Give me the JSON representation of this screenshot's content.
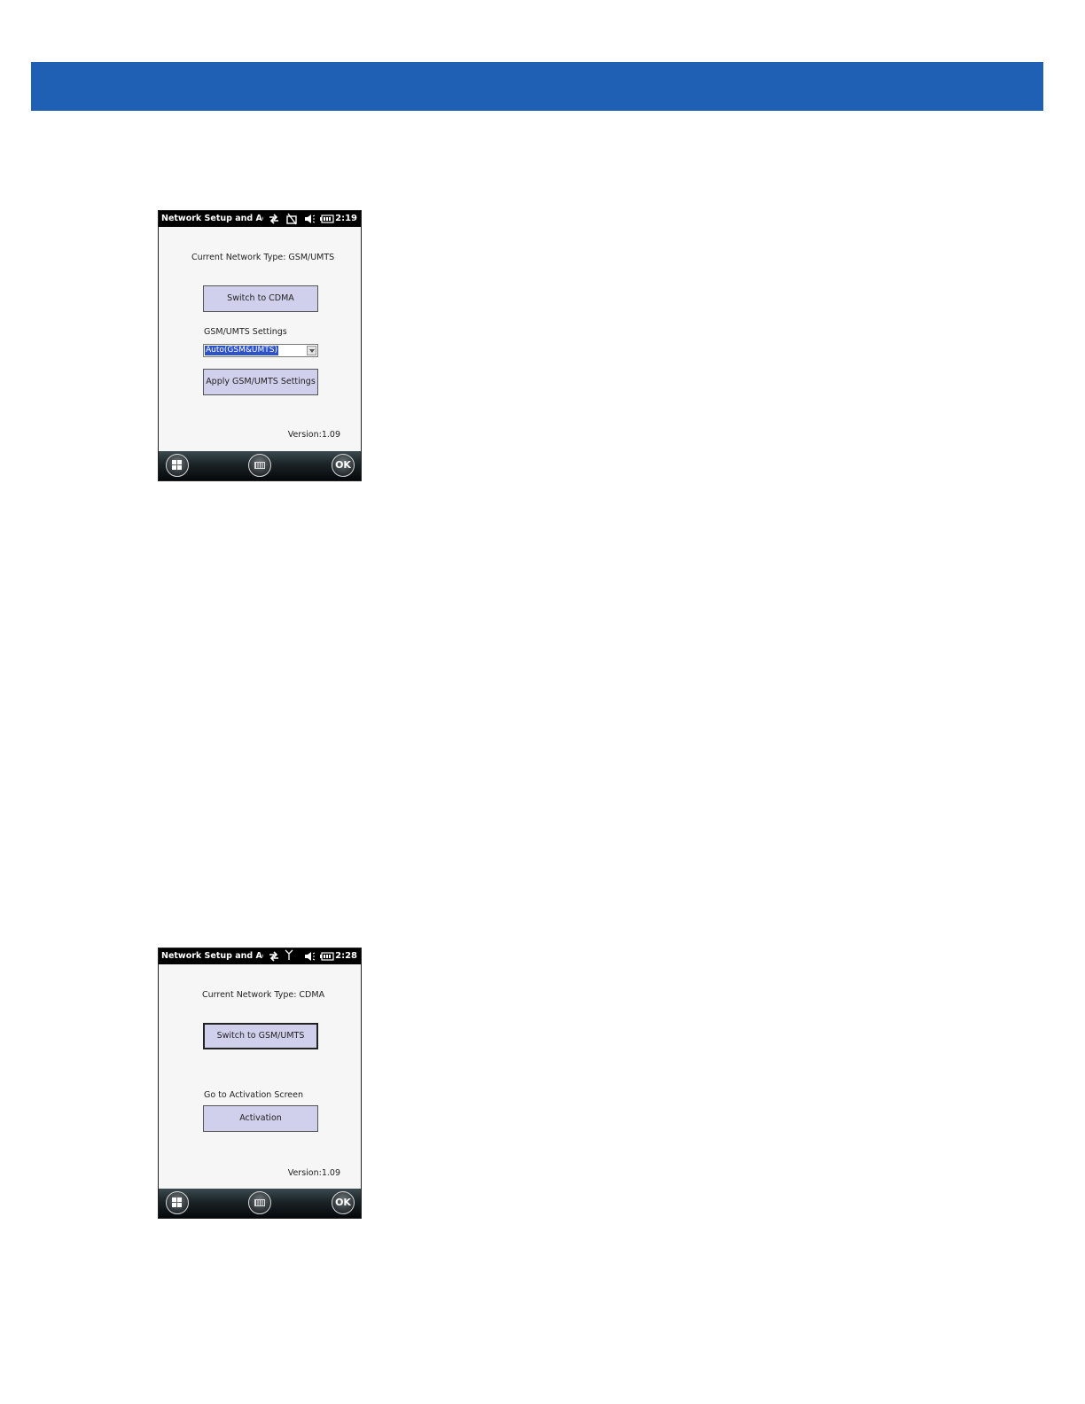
{
  "screen1": {
    "status": {
      "title": "Network Setup and Act",
      "time": "2:19",
      "icons": [
        "data-transfer-icon",
        "no-sim-icon",
        "speaker-icon",
        "battery-icon"
      ]
    },
    "network_type_label": "Current Network Type: GSM/UMTS",
    "switch_button": "Switch to CDMA",
    "settings_label": "GSM/UMTS Settings",
    "settings_select_value": "Auto(GSM&UMTS)",
    "apply_button": "Apply GSM/UMTS Settings",
    "version": "Version:1.09",
    "taskbar": {
      "ok_label": "OK",
      "icons": [
        "windows-start-icon",
        "keyboard-icon"
      ]
    }
  },
  "screen2": {
    "status": {
      "title": "Network Setup and Act",
      "time": "2:28",
      "icons": [
        "data-transfer-icon",
        "signal-antenna-icon",
        "speaker-icon",
        "battery-icon"
      ]
    },
    "network_type_label": "Current Network Type: CDMA",
    "switch_button": "Switch to GSM/UMTS",
    "activation_label": "Go to Activation Screen",
    "activation_button": "Activation",
    "version": "Version:1.09",
    "taskbar": {
      "ok_label": "OK",
      "icons": [
        "windows-start-icon",
        "keyboard-icon"
      ]
    }
  },
  "colors": {
    "header_bar": "#1f5fb4",
    "button_fill": "#d0d0ec",
    "selection": "#2e53c6"
  }
}
